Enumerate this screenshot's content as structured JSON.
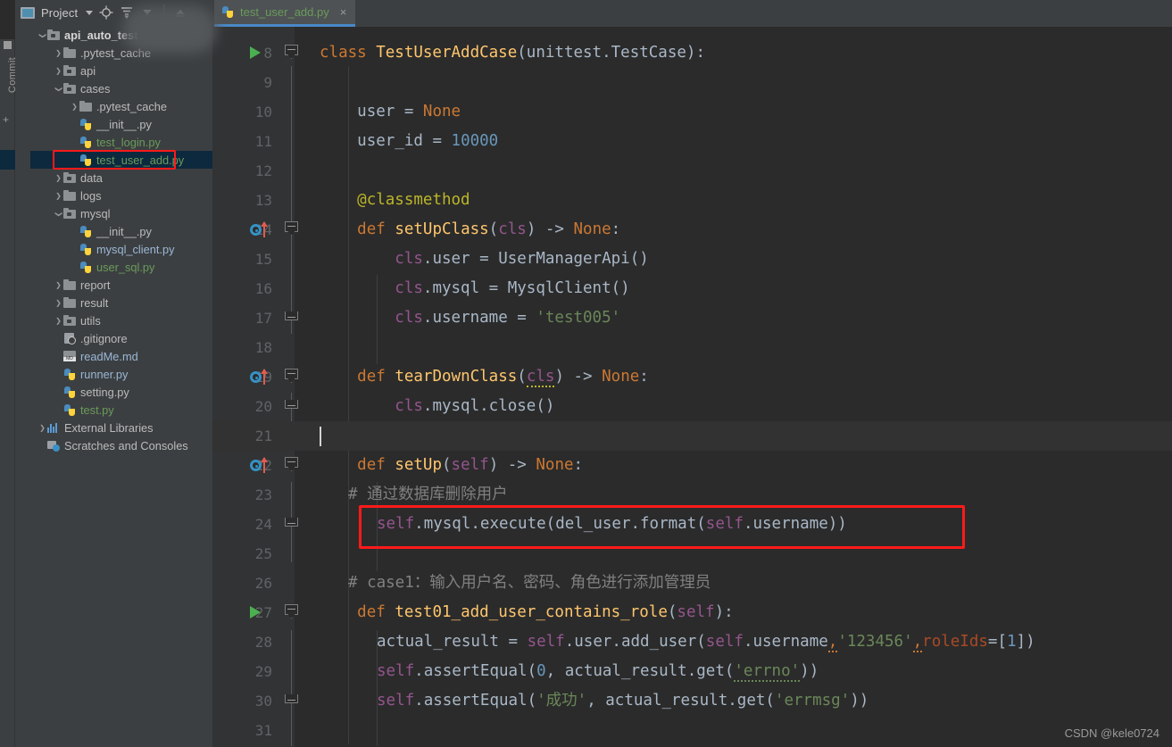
{
  "window": {
    "watermark": "CSDN @kele0724"
  },
  "toolwindow_strip": {
    "label": "Commit"
  },
  "project_panel": {
    "title": "Project",
    "icons": [
      "project-icon",
      "chevron-down-icon",
      "locate-icon",
      "collapse-all-icon",
      "settings-dropdown-icon",
      "hide-icon"
    ],
    "tree": [
      {
        "label": "api_auto_test",
        "depth": 0,
        "arrow": "down",
        "icon": "folder-module",
        "style": "bold"
      },
      {
        "label": ".pytest_cache",
        "depth": 1,
        "arrow": "right",
        "icon": "folder",
        "style": ""
      },
      {
        "label": "api",
        "depth": 1,
        "arrow": "right",
        "icon": "folder-module",
        "style": ""
      },
      {
        "label": "cases",
        "depth": 1,
        "arrow": "down",
        "icon": "folder-module",
        "style": ""
      },
      {
        "label": ".pytest_cache",
        "depth": 2,
        "arrow": "right",
        "icon": "folder",
        "style": ""
      },
      {
        "label": "__init__.py",
        "depth": 2,
        "arrow": "none",
        "icon": "python-file",
        "style": ""
      },
      {
        "label": "test_login.py",
        "depth": 2,
        "arrow": "none",
        "icon": "python-file",
        "style": "green"
      },
      {
        "label": "test_user_add.py",
        "depth": 2,
        "arrow": "none",
        "icon": "python-file",
        "style": "green",
        "selected": true,
        "highlighted": true
      },
      {
        "label": "data",
        "depth": 1,
        "arrow": "right",
        "icon": "folder-module",
        "style": ""
      },
      {
        "label": "logs",
        "depth": 1,
        "arrow": "right",
        "icon": "folder",
        "style": ""
      },
      {
        "label": "mysql",
        "depth": 1,
        "arrow": "down",
        "icon": "folder-module",
        "style": ""
      },
      {
        "label": "__init__.py",
        "depth": 2,
        "arrow": "none",
        "icon": "python-file",
        "style": ""
      },
      {
        "label": "mysql_client.py",
        "depth": 2,
        "arrow": "none",
        "icon": "python-file",
        "style": "blue"
      },
      {
        "label": "user_sql.py",
        "depth": 2,
        "arrow": "none",
        "icon": "python-file",
        "style": "green"
      },
      {
        "label": "report",
        "depth": 1,
        "arrow": "right",
        "icon": "folder",
        "style": ""
      },
      {
        "label": "result",
        "depth": 1,
        "arrow": "right",
        "icon": "folder",
        "style": ""
      },
      {
        "label": "utils",
        "depth": 1,
        "arrow": "right",
        "icon": "folder-module",
        "style": ""
      },
      {
        "label": ".gitignore",
        "depth": 1,
        "arrow": "none",
        "icon": "gitignore-file",
        "style": ""
      },
      {
        "label": "readMe.md",
        "depth": 1,
        "arrow": "none",
        "icon": "markdown-file",
        "style": "blue"
      },
      {
        "label": "runner.py",
        "depth": 1,
        "arrow": "none",
        "icon": "python-file",
        "style": "blue"
      },
      {
        "label": "setting.py",
        "depth": 1,
        "arrow": "none",
        "icon": "python-file",
        "style": ""
      },
      {
        "label": "test.py",
        "depth": 1,
        "arrow": "none",
        "icon": "python-file",
        "style": "green"
      },
      {
        "label": "External Libraries",
        "depth": 0,
        "arrow": "right",
        "icon": "libraries",
        "style": ""
      },
      {
        "label": "Scratches and Consoles",
        "depth": 0,
        "arrow": "none",
        "icon": "scratches",
        "style": ""
      }
    ]
  },
  "editor": {
    "tab": {
      "filename": "test_user_add.py",
      "icon": "python-file",
      "close": "×"
    },
    "lines": [
      {
        "num": "8",
        "gutter": "run",
        "fold": "start"
      },
      {
        "num": "9",
        "gutter": "",
        "fold": ""
      },
      {
        "num": "10",
        "gutter": "",
        "fold": ""
      },
      {
        "num": "11",
        "gutter": "",
        "fold": ""
      },
      {
        "num": "12",
        "gutter": "",
        "fold": ""
      },
      {
        "num": "13",
        "gutter": "",
        "fold": ""
      },
      {
        "num": "14",
        "gutter": "override",
        "fold": "start"
      },
      {
        "num": "15",
        "gutter": "",
        "fold": ""
      },
      {
        "num": "16",
        "gutter": "",
        "fold": ""
      },
      {
        "num": "17",
        "gutter": "",
        "fold": "end"
      },
      {
        "num": "18",
        "gutter": "",
        "fold": ""
      },
      {
        "num": "19",
        "gutter": "override",
        "fold": "start"
      },
      {
        "num": "20",
        "gutter": "",
        "fold": "end"
      },
      {
        "num": "21",
        "gutter": "",
        "fold": "",
        "caret": true
      },
      {
        "num": "22",
        "gutter": "override",
        "fold": "start"
      },
      {
        "num": "23",
        "gutter": "",
        "fold": ""
      },
      {
        "num": "24",
        "gutter": "",
        "fold": "end"
      },
      {
        "num": "25",
        "gutter": "",
        "fold": ""
      },
      {
        "num": "26",
        "gutter": "",
        "fold": ""
      },
      {
        "num": "27",
        "gutter": "run",
        "fold": "start"
      },
      {
        "num": "28",
        "gutter": "",
        "fold": ""
      },
      {
        "num": "29",
        "gutter": "",
        "fold": ""
      },
      {
        "num": "30",
        "gutter": "",
        "fold": "end"
      },
      {
        "num": "31",
        "gutter": "",
        "fold": ""
      }
    ],
    "code": {
      "l8": "class TestUserAddCase(unittest.TestCase):",
      "l10": "user = None",
      "l11": "user_id = 10000",
      "l13": "@classmethod",
      "l14": "def setUpClass(cls) -> None:",
      "l15": "cls.user = UserManagerApi()",
      "l16": "cls.mysql = MysqlClient()",
      "l17": "cls.username = 'test005'",
      "l19": "def tearDownClass(cls) -> None:",
      "l20": "cls.mysql.close()",
      "l22": "def setUp(self) -> None:",
      "l23": "# 通过数据库删除用户",
      "l24": "self.mysql.execute(del_user.format(self.username))",
      "l26": "# case1：输入用户名、密码、角色进行添加管理员",
      "l27": "def test01_add_user_contains_role(self):",
      "l28": "actual_result = self.user.add_user(self.username,'123456',roleIds=[1])",
      "l29": "self.assertEqual(0, actual_result.get('errno'))",
      "l30": "self.assertEqual('成功', actual_result.get('errmsg'))"
    },
    "tokens": {
      "kw_class": "class",
      "cls_name": "TestUserAddCase",
      "base": "(unittest.TestCase):",
      "var_user": "user",
      "eq": " = ",
      "none": "None",
      "var_userid": "user_id",
      "num_10000": "10000",
      "decorator": "@classmethod",
      "kw_def": "def",
      "fn_setupclass": "setUpClass",
      "p_cls": "cls",
      "arrow_none": ") -> ",
      "colon": ":",
      "cls_user": "cls",
      "dot_user": ".user",
      "userapi": "UserManagerApi()",
      "dot_mysql": ".mysql",
      "mysqlclient": "MysqlClient()",
      "dot_username": ".username",
      "str_test005": "'test005'",
      "fn_teardown": "tearDownClass",
      "dot_close": ".mysql.close()",
      "fn_setup": "setUp",
      "p_self": "self",
      "cmt_line23": "#  通过数据库删除用户",
      "self_tok": "self",
      "exec_call": ".mysql.execute(del_user.format(",
      "exec_tail": ".username))",
      "cmt_line26": "# case1：输入用户名、密码、角色进行添加管理员",
      "fn_test01": "test01_add_user_contains_role",
      "actual": "actual_result",
      "add_user": ".user.add_user(",
      "username_ref": ".username",
      "comma": ",",
      "str_123456": "'123456'",
      "roleids": "roleIds",
      "eq_list": "=[",
      "num_1": "1",
      "close_br": "])",
      "assert_eq": ".assertEqual(",
      "num_0": "0",
      "get_errno": ", actual_result.get(",
      "str_errno": "'errno'",
      "close2": "))",
      "str_chenggong": "'成功'",
      "get_errmsg": ", actual_result.get(",
      "str_errmsg": "'errmsg'"
    }
  },
  "colors": {
    "editor_bg": "#2b2b2b",
    "panel_bg": "#3c3f41",
    "gutter_bg": "#313335",
    "selection": "#0d293e",
    "annotation_red": "#ff1a1a",
    "keyword": "#cc7832",
    "function": "#ffc66d",
    "string": "#6a8759",
    "number": "#6897bb",
    "comment": "#808080",
    "self_param": "#94558d",
    "decorator": "#bbb529",
    "default_text": "#a9b7c6",
    "tab_underline": "#4a88c7",
    "green_file": "#6a9b5b"
  }
}
